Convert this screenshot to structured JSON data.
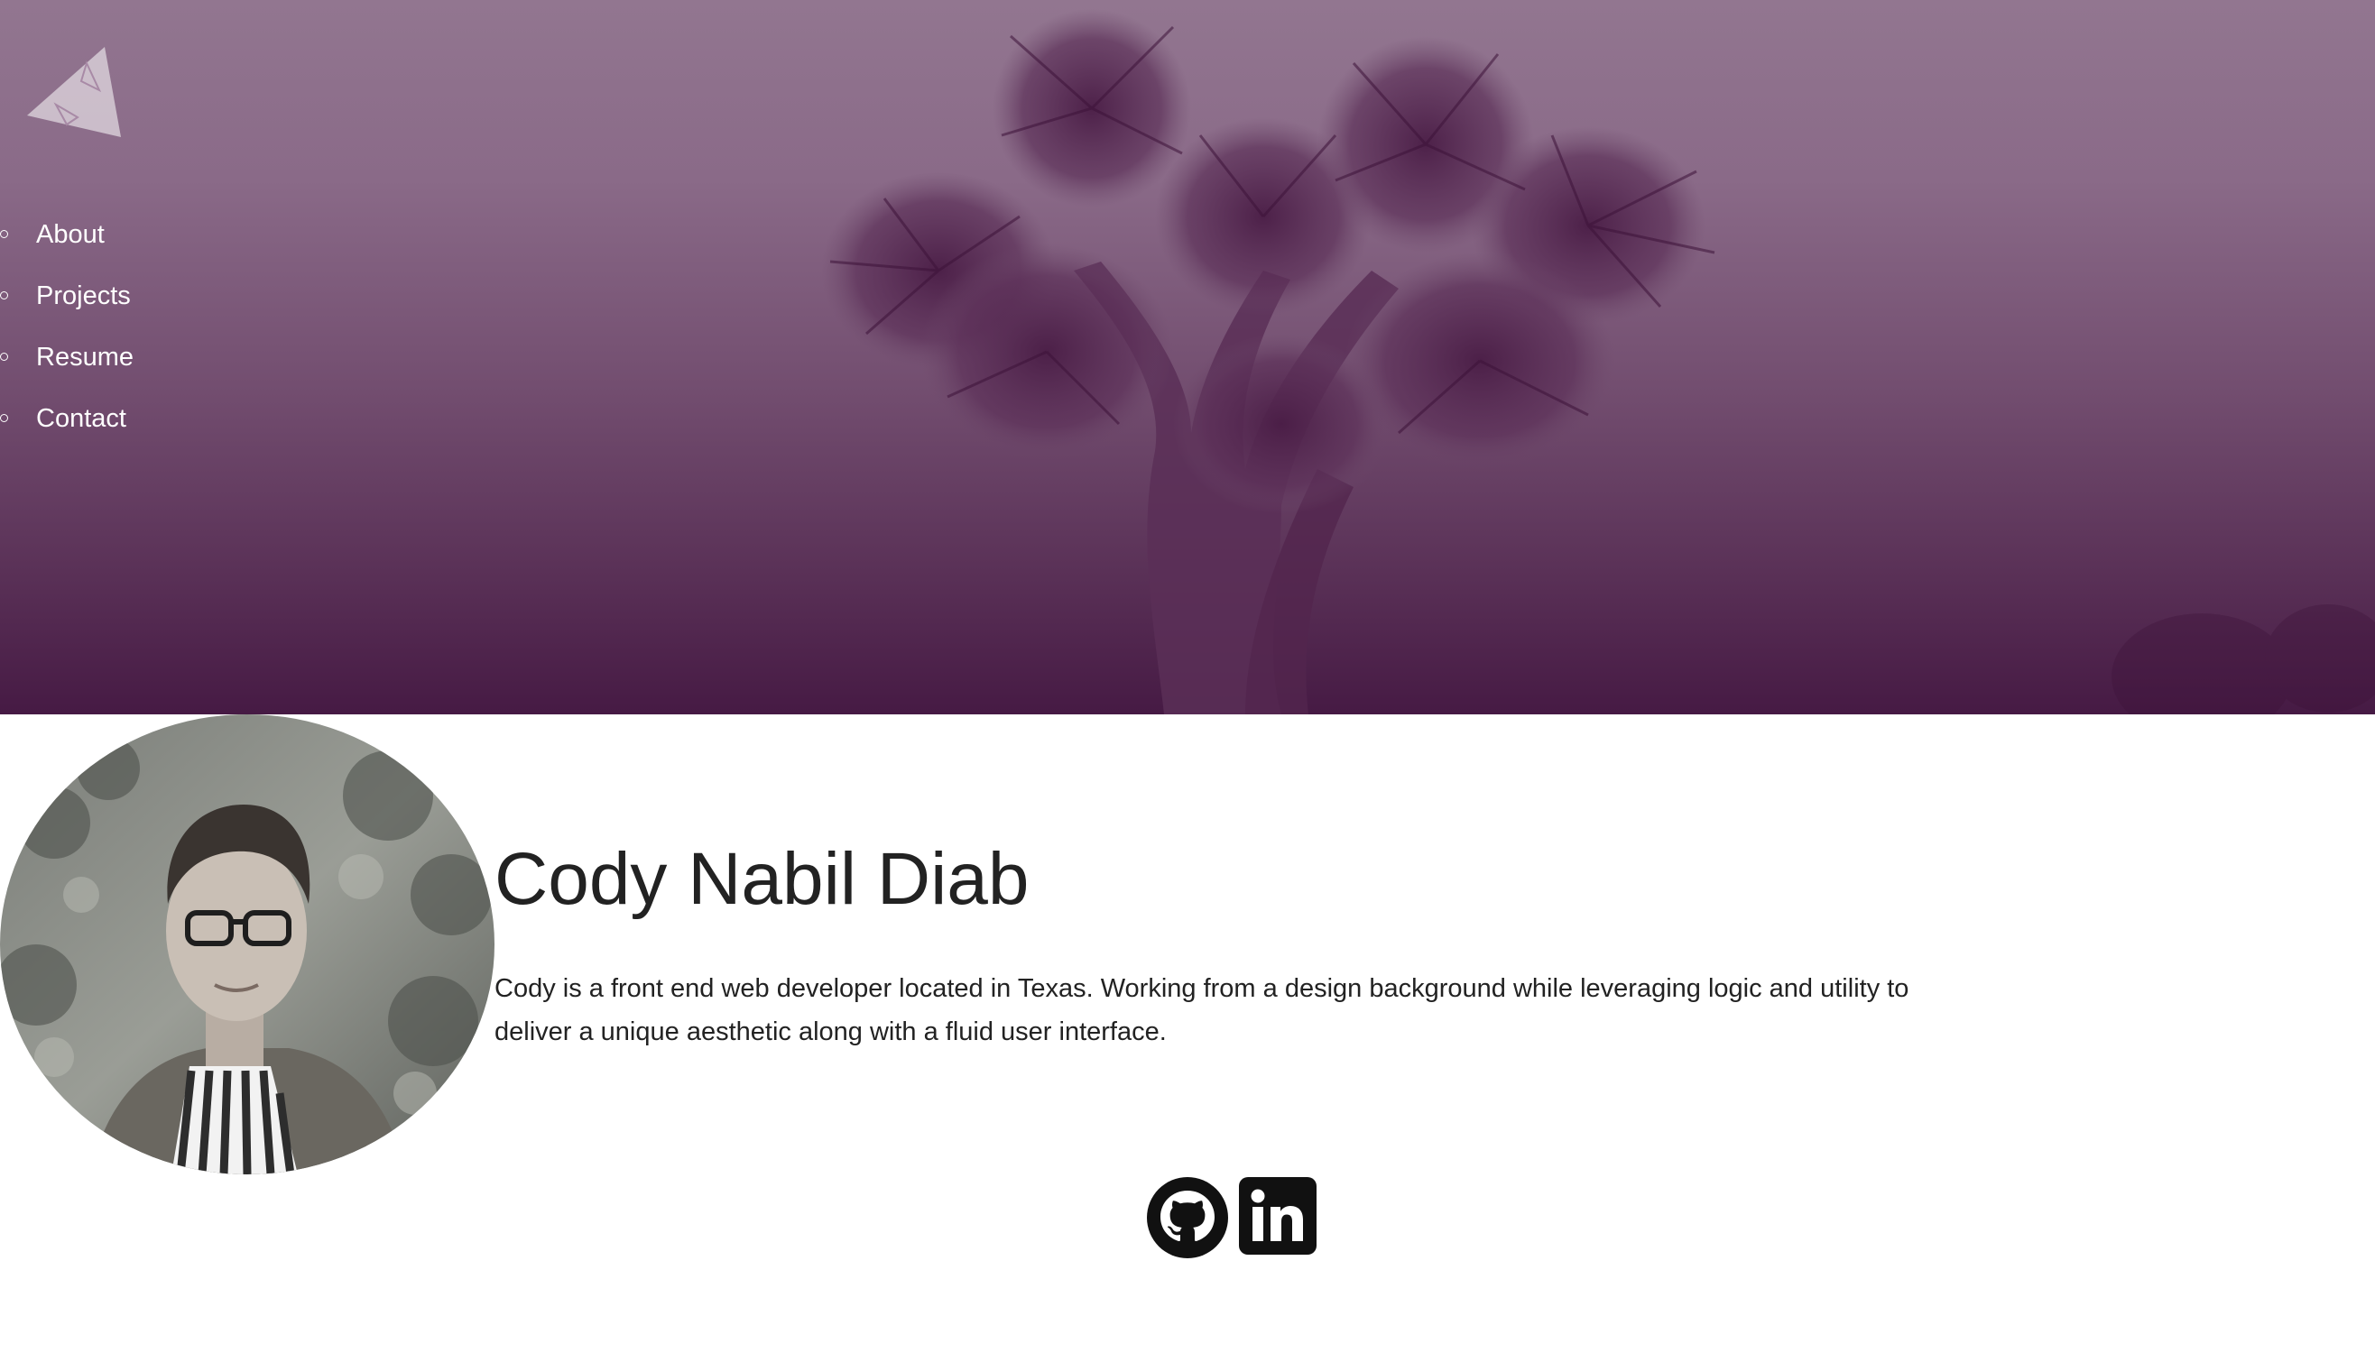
{
  "nav": {
    "items": [
      {
        "label": "About"
      },
      {
        "label": "Projects"
      },
      {
        "label": "Resume"
      },
      {
        "label": "Contact"
      }
    ]
  },
  "profile": {
    "name": "Cody Nabil Diab",
    "bio": "Cody is a front end web developer located in Texas. Working from a design background while leveraging logic and utility to deliver a unique aesthetic along with a fluid user interface."
  },
  "socials": [
    {
      "icon": "github-icon"
    },
    {
      "icon": "linkedin-icon"
    }
  ],
  "colors": {
    "hero_top": "#927690",
    "hero_bottom": "#461a44",
    "text": "#222222"
  }
}
